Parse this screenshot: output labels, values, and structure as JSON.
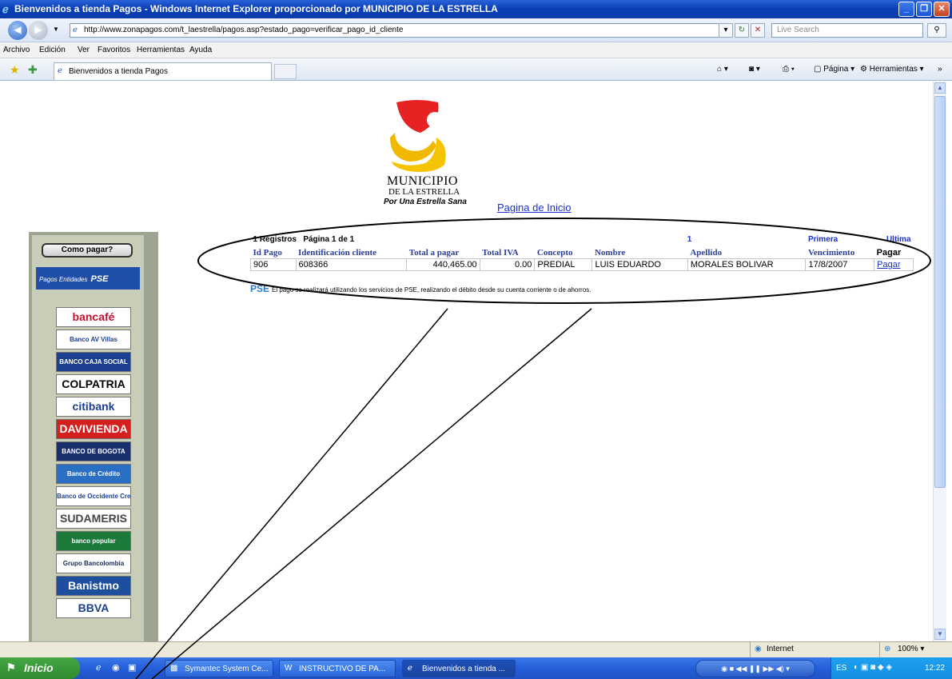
{
  "window": {
    "title": "Bienvenidos a tienda Pagos - Windows Internet Explorer proporcionado por MUNICIPIO DE LA ESTRELLA"
  },
  "addressbar": {
    "url": "http://www.zonapagos.com/t_laestrella/pagos.asp?estado_pago=verificar_pago_id_cliente",
    "search_placeholder": "Live Search"
  },
  "menu": [
    "Archivo",
    "Edición",
    "Ver",
    "Favoritos",
    "Herramientas",
    "Ayuda"
  ],
  "tabs": {
    "active_label": "Bienvenidos a tienda Pagos"
  },
  "command_bar": {
    "page_label": "Página",
    "tools_label": "Herramientas"
  },
  "page": {
    "logo_line1": "MUNICIPIO",
    "logo_line2": "DE LA ESTRELLA",
    "slogan": "Por Una Estrella Sana",
    "home_link": "Pagina de Inicio"
  },
  "sidebar": {
    "como_pagar": "Como pagar?",
    "pse_label": "Pagos Entidades",
    "pse_brand": "PSE",
    "banks": [
      {
        "name": "bancafé",
        "color": "#c8102e",
        "bg": "#ffffff"
      },
      {
        "name": "Banco AV Villas",
        "color": "#1b3e8f",
        "bg": "#ffffff"
      },
      {
        "name": "BANCO CAJA SOCIAL",
        "color": "#ffffff",
        "bg": "#1d3f8f"
      },
      {
        "name": "COLPATRIA",
        "color": "#000000",
        "bg": "#ffffff"
      },
      {
        "name": "citibank",
        "color": "#1b3e8f",
        "bg": "#ffffff"
      },
      {
        "name": "DAVIVIENDA",
        "color": "#ffffff",
        "bg": "#d2201f"
      },
      {
        "name": "BANCO DE BOGOTA",
        "color": "#ffffff",
        "bg": "#1a2f6e"
      },
      {
        "name": "Banco de Crédito",
        "color": "#ffffff",
        "bg": "#2a6fc4"
      },
      {
        "name": "Banco de Occidente Credencial",
        "color": "#1b3e8f",
        "bg": "#ffffff"
      },
      {
        "name": "SUDAMERIS",
        "color": "#444444",
        "bg": "#ffffff"
      },
      {
        "name": "banco popular",
        "color": "#ffffff",
        "bg": "#1c7a3a"
      },
      {
        "name": "Grupo Bancolombia",
        "color": "#1b2b5a",
        "bg": "#ffffff"
      },
      {
        "name": "Banistmo",
        "color": "#ffffff",
        "bg": "#1d4f9e"
      },
      {
        "name": "BBVA",
        "color": "#1b3e8f",
        "bg": "#ffffff"
      }
    ]
  },
  "results": {
    "registros": "1 Registros",
    "pagina": "Página 1 de 1",
    "page_number": "1",
    "first": "Primera",
    "last": "Ultima",
    "headers": [
      "Id Pago",
      "Identificación cliente",
      "Total a pagar",
      "Total IVA",
      "Concepto",
      "Nombre",
      "Apellido",
      "Vencimiento",
      "Pagar"
    ],
    "rows": [
      [
        "906",
        "608366",
        "440,465.00",
        "0.00",
        "PREDIAL",
        "LUIS EDUARDO",
        "MORALES BOLIVAR",
        "17/8/2007",
        "Pagar"
      ]
    ],
    "pse_note": "El pago se realizará utilizando los servicios de PSE, realizando el débito desde su cuenta corriente o de ahorros."
  },
  "statusbar": {
    "zone": "Internet",
    "zoom": "100%"
  },
  "taskbar": {
    "start": "Inicio",
    "tasks": [
      "Symantec System Ce...",
      "INSTRUCTIVO DE PA...",
      "Bienvenidos a tienda ..."
    ],
    "lang": "ES",
    "clock": "12:22"
  }
}
